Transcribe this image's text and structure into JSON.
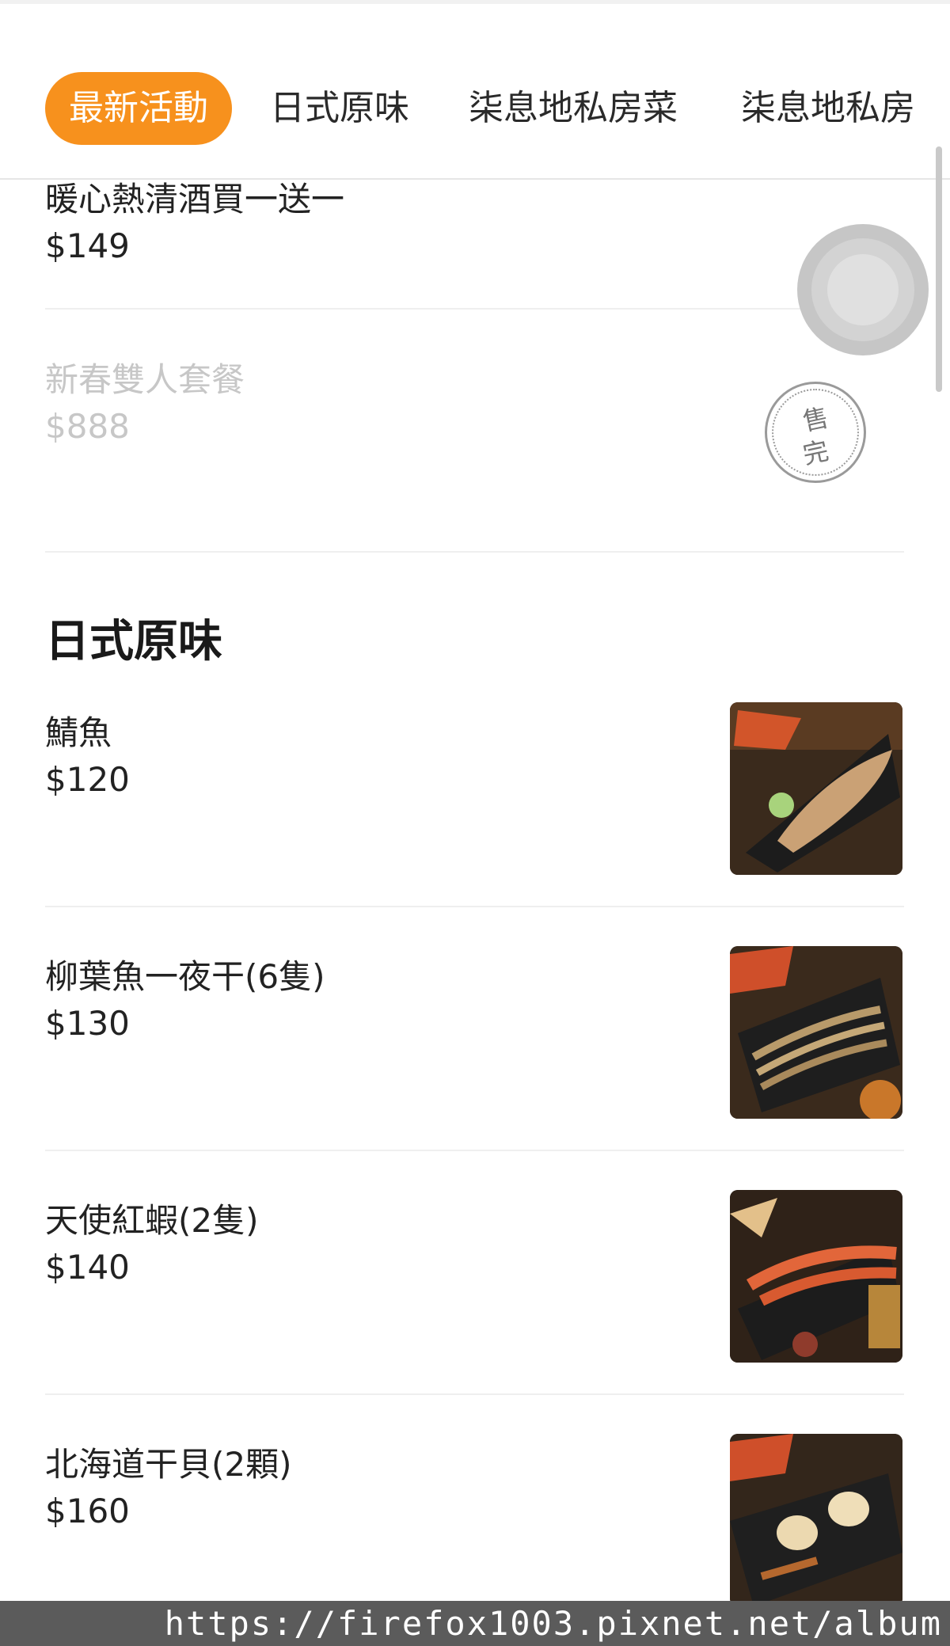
{
  "tabs": [
    {
      "label": "最新活動",
      "active": true
    },
    {
      "label": "日式原味",
      "active": false
    },
    {
      "label": "柒息地私房菜",
      "active": false
    },
    {
      "label": "柒息地私房",
      "active": false
    }
  ],
  "promo_items": [
    {
      "name": "暖心熱清酒買一送一",
      "price": "$149",
      "sold_out": false
    },
    {
      "name": "新春雙人套餐",
      "price": "$888",
      "sold_out": true
    }
  ],
  "sold_out_stamp": [
    "售",
    "完"
  ],
  "section": {
    "title": "日式原味"
  },
  "menu_items": [
    {
      "name": "鯖魚",
      "price": "$120"
    },
    {
      "name": "柳葉魚一夜干(6隻)",
      "price": "$130"
    },
    {
      "name": "天使紅蝦(2隻)",
      "price": "$140"
    },
    {
      "name": "北海道干貝(2顆)",
      "price": "$160"
    }
  ],
  "watermark": "https://firefox1003.pixnet.net/album",
  "colors": {
    "accent": "#f7911d",
    "soldout_text": "#c7c7c7"
  }
}
